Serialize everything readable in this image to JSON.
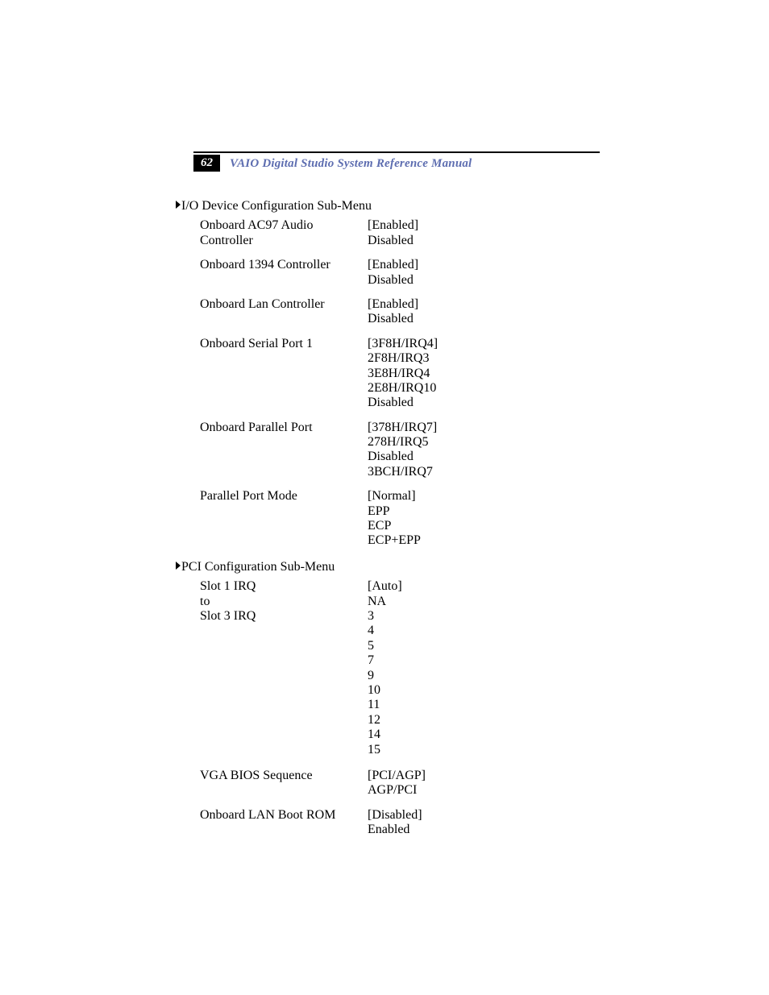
{
  "header": {
    "page_number": "62",
    "title": "VAIO Digital Studio System Reference Manual"
  },
  "sections": [
    {
      "heading": "I/O Device Configuration Sub-Menu",
      "items": [
        {
          "label": "Onboard AC97 Audio Controller",
          "values": "[Enabled]\nDisabled"
        },
        {
          "label": "Onboard 1394 Controller",
          "values": "[Enabled]\nDisabled"
        },
        {
          "label": "Onboard Lan Controller",
          "values": "[Enabled]\nDisabled"
        },
        {
          "label": "Onboard Serial Port 1",
          "values": "[3F8H/IRQ4]\n2F8H/IRQ3\n3E8H/IRQ4\n2E8H/IRQ10\nDisabled"
        },
        {
          "label": "Onboard Parallel Port",
          "values": "[378H/IRQ7]\n278H/IRQ5\nDisabled\n3BCH/IRQ7"
        },
        {
          "label": "Parallel Port Mode",
          "values": "[Normal]\nEPP\nECP\nECP+EPP"
        }
      ]
    },
    {
      "heading": "PCI Configuration Sub-Menu",
      "items": [
        {
          "label": "Slot 1 IRQ\nto\nSlot 3 IRQ",
          "values": "[Auto]\nNA\n3\n4\n5\n7\n9\n10\n11\n12\n14\n15"
        },
        {
          "label": "VGA BIOS Sequence",
          "values": "[PCI/AGP]\nAGP/PCI"
        },
        {
          "label": "Onboard LAN Boot ROM",
          "values": "[Disabled]\nEnabled"
        }
      ]
    }
  ]
}
